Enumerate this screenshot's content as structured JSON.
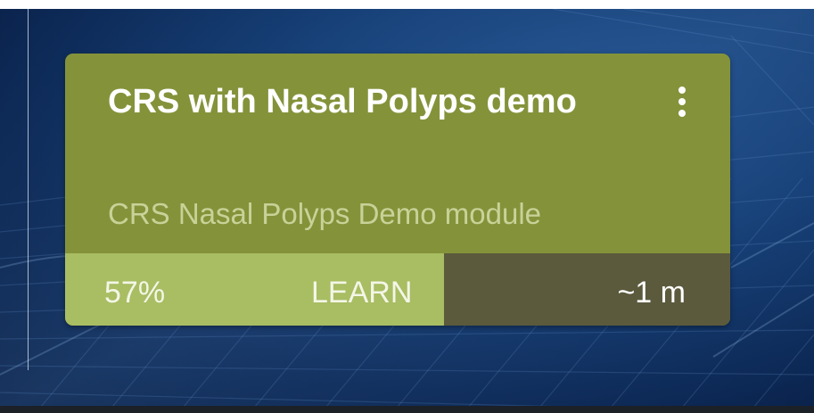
{
  "card": {
    "title": "CRS with Nasal Polyps demo",
    "subtitle": "CRS Nasal Polyps Demo module",
    "menu_icon": "more-vertical-icon",
    "progress": {
      "value": 57,
      "label": "57%",
      "fill_color": "#a9bd63"
    },
    "action_label": "LEARN",
    "duration": "~1 m"
  },
  "colors": {
    "card_background": "#84933a",
    "footer_background": "#5b5a3d",
    "subtitle_text": "#c8d298",
    "page_background": "#0d2a55"
  }
}
